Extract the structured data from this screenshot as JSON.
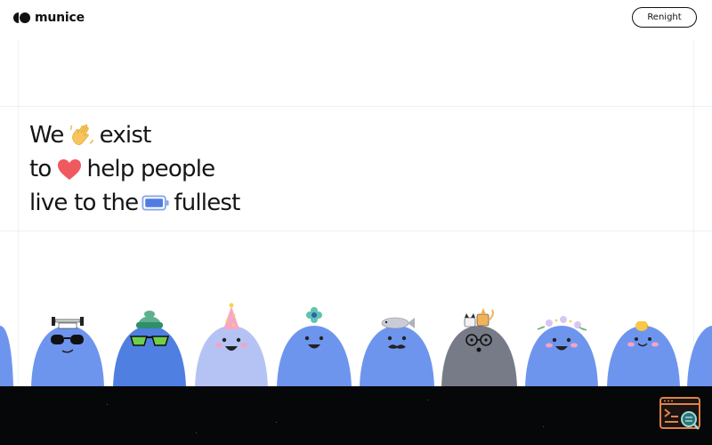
{
  "header": {
    "logo_text": "munice",
    "cta_label": "Renight"
  },
  "hero": {
    "line1_part1": "We",
    "line1_emoji": "waving-hand-icon",
    "line1_part2": "exist",
    "line2_part1": "to",
    "line2_emoji": "heart-icon",
    "line2_part2": "help people",
    "line3_part1": "live to the",
    "line3_emoji": "battery-icon",
    "line3_part2": "fullest"
  },
  "characters": [
    {
      "accessory": "partial-character"
    },
    {
      "accessory": "dumbbell-and-sunglasses"
    },
    {
      "accessory": "beanie-and-green-sunglasses"
    },
    {
      "accessory": "party-hat"
    },
    {
      "accessory": "flower"
    },
    {
      "accessory": "fish-and-mustache"
    },
    {
      "accessory": "cats-and-glasses"
    },
    {
      "accessory": "flower-crown"
    },
    {
      "accessory": "chick"
    },
    {
      "accessory": "partial-character"
    }
  ],
  "colors": {
    "blob_blue": "#6e95ee",
    "blob_dark_blue": "#5a82e4",
    "blob_lavender": "#b5c3f4",
    "blob_gray": "#777b88",
    "heart": "#f0595f",
    "bottom_band": "#060708",
    "text": "#151515"
  }
}
